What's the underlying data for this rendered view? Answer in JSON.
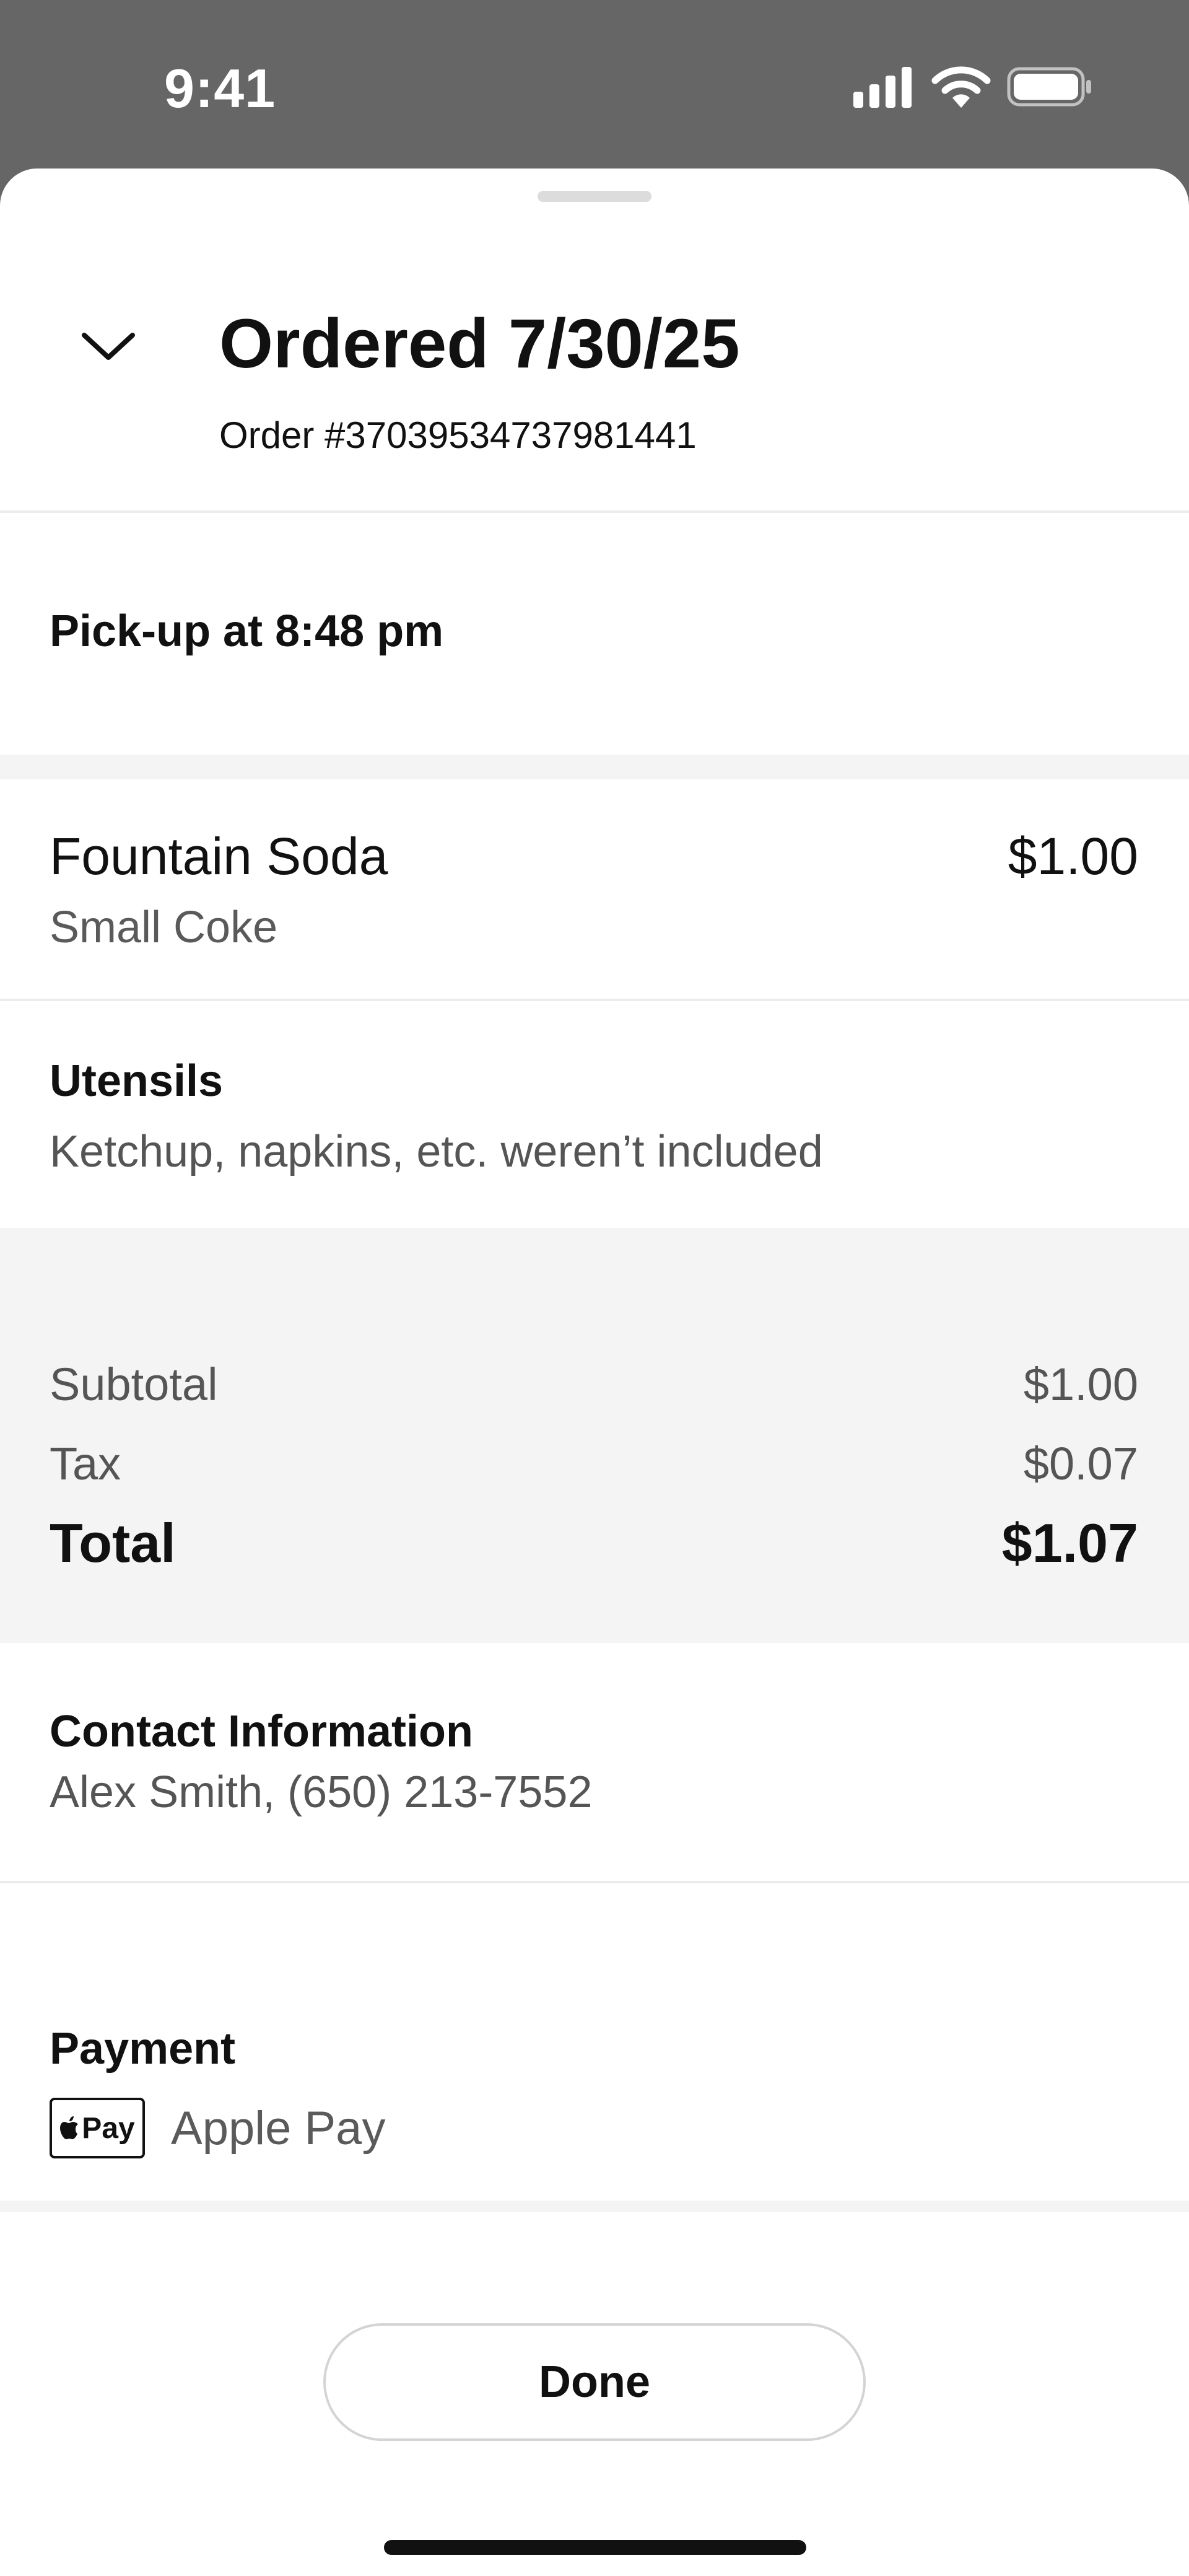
{
  "status_bar": {
    "time": "9:41",
    "icons": [
      "cellular-signal-icon",
      "wifi-icon",
      "battery-icon"
    ]
  },
  "order": {
    "title": "Ordered 7/30/25",
    "number": "Order #37039534737981441"
  },
  "pickup": {
    "label": "Pick-up at 8:48 pm"
  },
  "items": [
    {
      "name": "Fountain Soda",
      "variant": "Small Coke",
      "price": "$1.00"
    }
  ],
  "utensils": {
    "heading": "Utensils",
    "note": "Ketchup, napkins, etc. weren’t included"
  },
  "summary": {
    "subtotal_label": "Subtotal",
    "subtotal_value": "$1.00",
    "tax_label": "Tax",
    "tax_value": "$0.07",
    "total_label": "Total",
    "total_value": "$1.07"
  },
  "contact": {
    "heading": "Contact Information",
    "value": "Alex Smith, (650) 213-7552"
  },
  "payment": {
    "heading": "Payment",
    "badge": "Pay",
    "method": "Apple Pay"
  },
  "actions": {
    "done_label": "Done"
  },
  "colors": {
    "status_bar_bg": "#666666",
    "text_primary": "#111111",
    "text_secondary": "#555555",
    "summary_band": "#f4f4f4"
  }
}
